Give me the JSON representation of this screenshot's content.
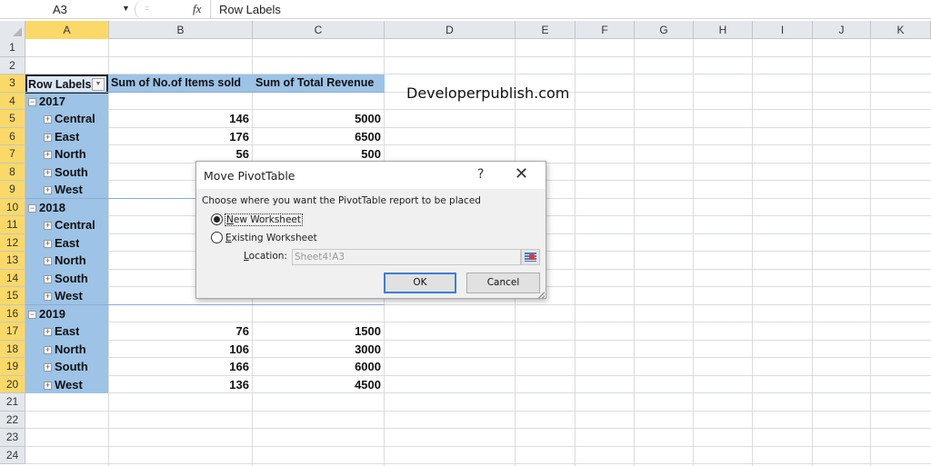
{
  "formula_bar": {
    "name_box": "A3",
    "fx_label": "fx",
    "formula": "Row Labels"
  },
  "columns": [
    "A",
    "B",
    "C",
    "D",
    "E",
    "F",
    "G",
    "H",
    "I",
    "J",
    "K"
  ],
  "rows": [
    "1",
    "2",
    "3",
    "4",
    "5",
    "6",
    "7",
    "8",
    "9",
    "10",
    "11",
    "12",
    "13",
    "14",
    "15",
    "16",
    "17",
    "18",
    "19",
    "20",
    "21",
    "22",
    "23",
    "24"
  ],
  "pivot": {
    "headers": {
      "row_labels": "Row Labels",
      "items_sold": "Sum of No.of Items sold",
      "total_revenue": "Sum of Total Revenue"
    },
    "rows": [
      {
        "row": 4,
        "type": "year",
        "label": "2017",
        "items": "",
        "revenue": ""
      },
      {
        "row": 5,
        "type": "region",
        "label": "Central",
        "items": "146",
        "revenue": "5000"
      },
      {
        "row": 6,
        "type": "region",
        "label": "East",
        "items": "176",
        "revenue": "6500"
      },
      {
        "row": 7,
        "type": "region",
        "label": "North",
        "items": "56",
        "revenue": "500"
      },
      {
        "row": 8,
        "type": "region",
        "label": "South",
        "items": "",
        "revenue": ""
      },
      {
        "row": 9,
        "type": "region",
        "label": "West",
        "items": "",
        "revenue": ""
      },
      {
        "row": 10,
        "type": "year",
        "label": "2018",
        "items": "",
        "revenue": ""
      },
      {
        "row": 11,
        "type": "region",
        "label": "Central",
        "items": "",
        "revenue": ""
      },
      {
        "row": 12,
        "type": "region",
        "label": "East",
        "items": "",
        "revenue": ""
      },
      {
        "row": 13,
        "type": "region",
        "label": "North",
        "items": "",
        "revenue": ""
      },
      {
        "row": 14,
        "type": "region",
        "label": "South",
        "items": "",
        "revenue": ""
      },
      {
        "row": 15,
        "type": "region",
        "label": "West",
        "items": "",
        "revenue": ""
      },
      {
        "row": 16,
        "type": "year",
        "label": "2019",
        "items": "",
        "revenue": ""
      },
      {
        "row": 17,
        "type": "region",
        "label": "East",
        "items": "76",
        "revenue": "1500"
      },
      {
        "row": 18,
        "type": "region",
        "label": "North",
        "items": "106",
        "revenue": "3000"
      },
      {
        "row": 19,
        "type": "region",
        "label": "South",
        "items": "166",
        "revenue": "6000"
      },
      {
        "row": 20,
        "type": "region",
        "label": "West",
        "items": "136",
        "revenue": "4500"
      }
    ]
  },
  "watermark": "Developerpublish.com",
  "dialog": {
    "title": "Move PivotTable",
    "help": "?",
    "close": "✕",
    "prompt": "Choose where you want the PivotTable report to be placed",
    "option_new": {
      "pre": "",
      "accel": "N",
      "post": "ew Worksheet",
      "selected": true
    },
    "option_existing": {
      "pre": "",
      "accel": "E",
      "post": "xisting Worksheet",
      "selected": false
    },
    "location_label": {
      "accel": "L",
      "post": "ocation:"
    },
    "location_value": "Sheet4!A3",
    "ok": "OK",
    "cancel": "Cancel"
  },
  "colors": {
    "selected_header": "#fbd968",
    "pivot_fill": "#9dc3e6",
    "ok_border": "#3c7fd3"
  }
}
